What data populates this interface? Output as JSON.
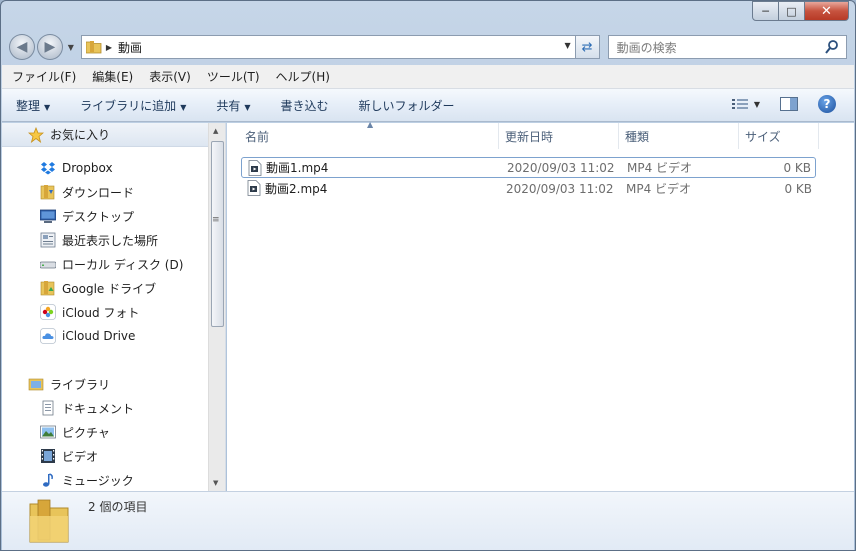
{
  "address": {
    "crumb": "動画",
    "search_placeholder": "動画の検索"
  },
  "menu": [
    "ファイル(F)",
    "編集(E)",
    "表示(V)",
    "ツール(T)",
    "ヘルプ(H)"
  ],
  "commands": {
    "organize": "整理",
    "add_to_library": "ライブラリに追加",
    "share": "共有",
    "burn": "書き込む",
    "new_folder": "新しいフォルダー"
  },
  "nav": {
    "favorites_label": "お気に入り",
    "items": [
      "Dropbox",
      "ダウンロード",
      "デスクトップ",
      "最近表示した場所",
      "ローカル ディスク (D)",
      "Google ドライブ",
      "iCloud フォト",
      "iCloud Drive"
    ],
    "libraries_label": "ライブラリ",
    "library_items": [
      "ドキュメント",
      "ピクチャ",
      "ビデオ",
      "ミュージック"
    ]
  },
  "columns": {
    "name": "名前",
    "modified": "更新日時",
    "type": "種類",
    "size": "サイズ"
  },
  "files": [
    {
      "name": "動画1.mp4",
      "modified": "2020/09/03 11:02",
      "type": "MP4 ビデオ",
      "size": "0 KB"
    },
    {
      "name": "動画2.mp4",
      "modified": "2020/09/03 11:02",
      "type": "MP4 ビデオ",
      "size": "0 KB"
    }
  ],
  "status": {
    "item_count": "2 個の項目"
  }
}
